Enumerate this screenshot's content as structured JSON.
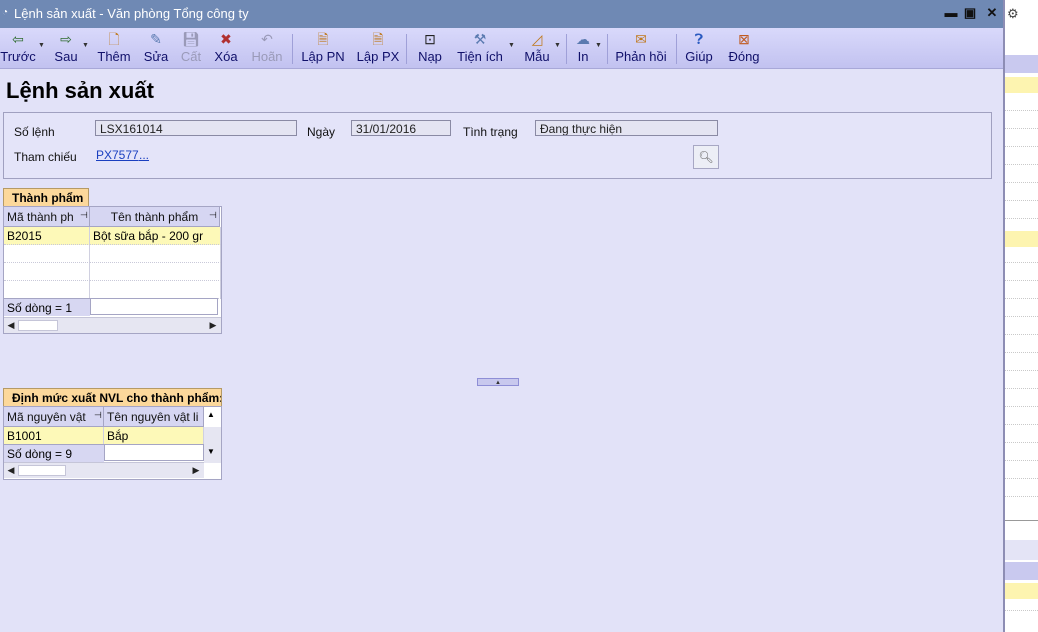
{
  "window": {
    "title": "Lệnh sản xuất - Văn phòng Tổng công ty"
  },
  "toolbar": {
    "prev": "Trước",
    "next": "Sau",
    "add": "Thêm",
    "edit": "Sửa",
    "save": "Cất",
    "delete": "Xóa",
    "undo": "Hoãn",
    "create_pn": "Lập PN",
    "create_px": "Lập PX",
    "load": "Nạp",
    "utilities": "Tiện ích",
    "template": "Mẫu",
    "print": "In",
    "feedback": "Phản hồi",
    "help": "Giúp",
    "close": "Đóng"
  },
  "page": {
    "heading": "Lệnh sản xuất"
  },
  "form": {
    "order_no_label": "Số lệnh",
    "order_no": "LSX161014",
    "date_label": "Ngày",
    "date": "31/01/2016",
    "status_label": "Tình trạng",
    "status": "Đang thực hiện",
    "reference_label": "Tham chiếu",
    "reference": "PX7577",
    "reference_more": "..."
  },
  "products": {
    "tab": "Thành phẩm",
    "columns": [
      "Mã thành ph",
      "Tên thành phẩm"
    ],
    "rows": [
      {
        "code": "B2015",
        "name": "Bột sữa bắp - 200 gr"
      }
    ],
    "footer": "Số dòng = 1"
  },
  "materials": {
    "tab": "Định mức xuất NVL cho thành phẩm: B",
    "columns": [
      "Mã nguyên vật",
      "Tên nguyên vật li"
    ],
    "rows": [
      {
        "code": "B1001",
        "name": "Bắp"
      }
    ],
    "footer": "Số dòng = 9"
  },
  "colors": {
    "titlebar": "#6f89b4",
    "background": "#e2e2f8",
    "tab_header": "#fcd89b",
    "selected_row": "#fdf9b8",
    "link": "#1a3fc0"
  }
}
